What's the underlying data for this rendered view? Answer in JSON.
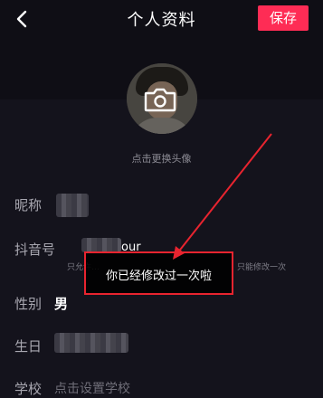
{
  "header": {
    "title": "个人资料",
    "save_label": "保存",
    "back_icon": "chevron-left-icon"
  },
  "avatar": {
    "camera_icon": "camera-icon",
    "hint": "点击更换头像"
  },
  "fields": {
    "nickname_label": "昵称",
    "douyin_id_label": "抖音号",
    "douyin_id_suffix": "our",
    "douyin_id_note_left": "只允许…",
    "douyin_id_note_right": "只能修改一次",
    "gender_label": "性别",
    "gender_value": "男",
    "birthday_label": "生日",
    "school_label": "学校",
    "school_placeholder": "点击设置学校"
  },
  "toast": {
    "message": "你已经修改过一次啦"
  },
  "colors": {
    "accent": "#fe2c55",
    "annotation": "#e8242f",
    "background": "#14131c"
  }
}
